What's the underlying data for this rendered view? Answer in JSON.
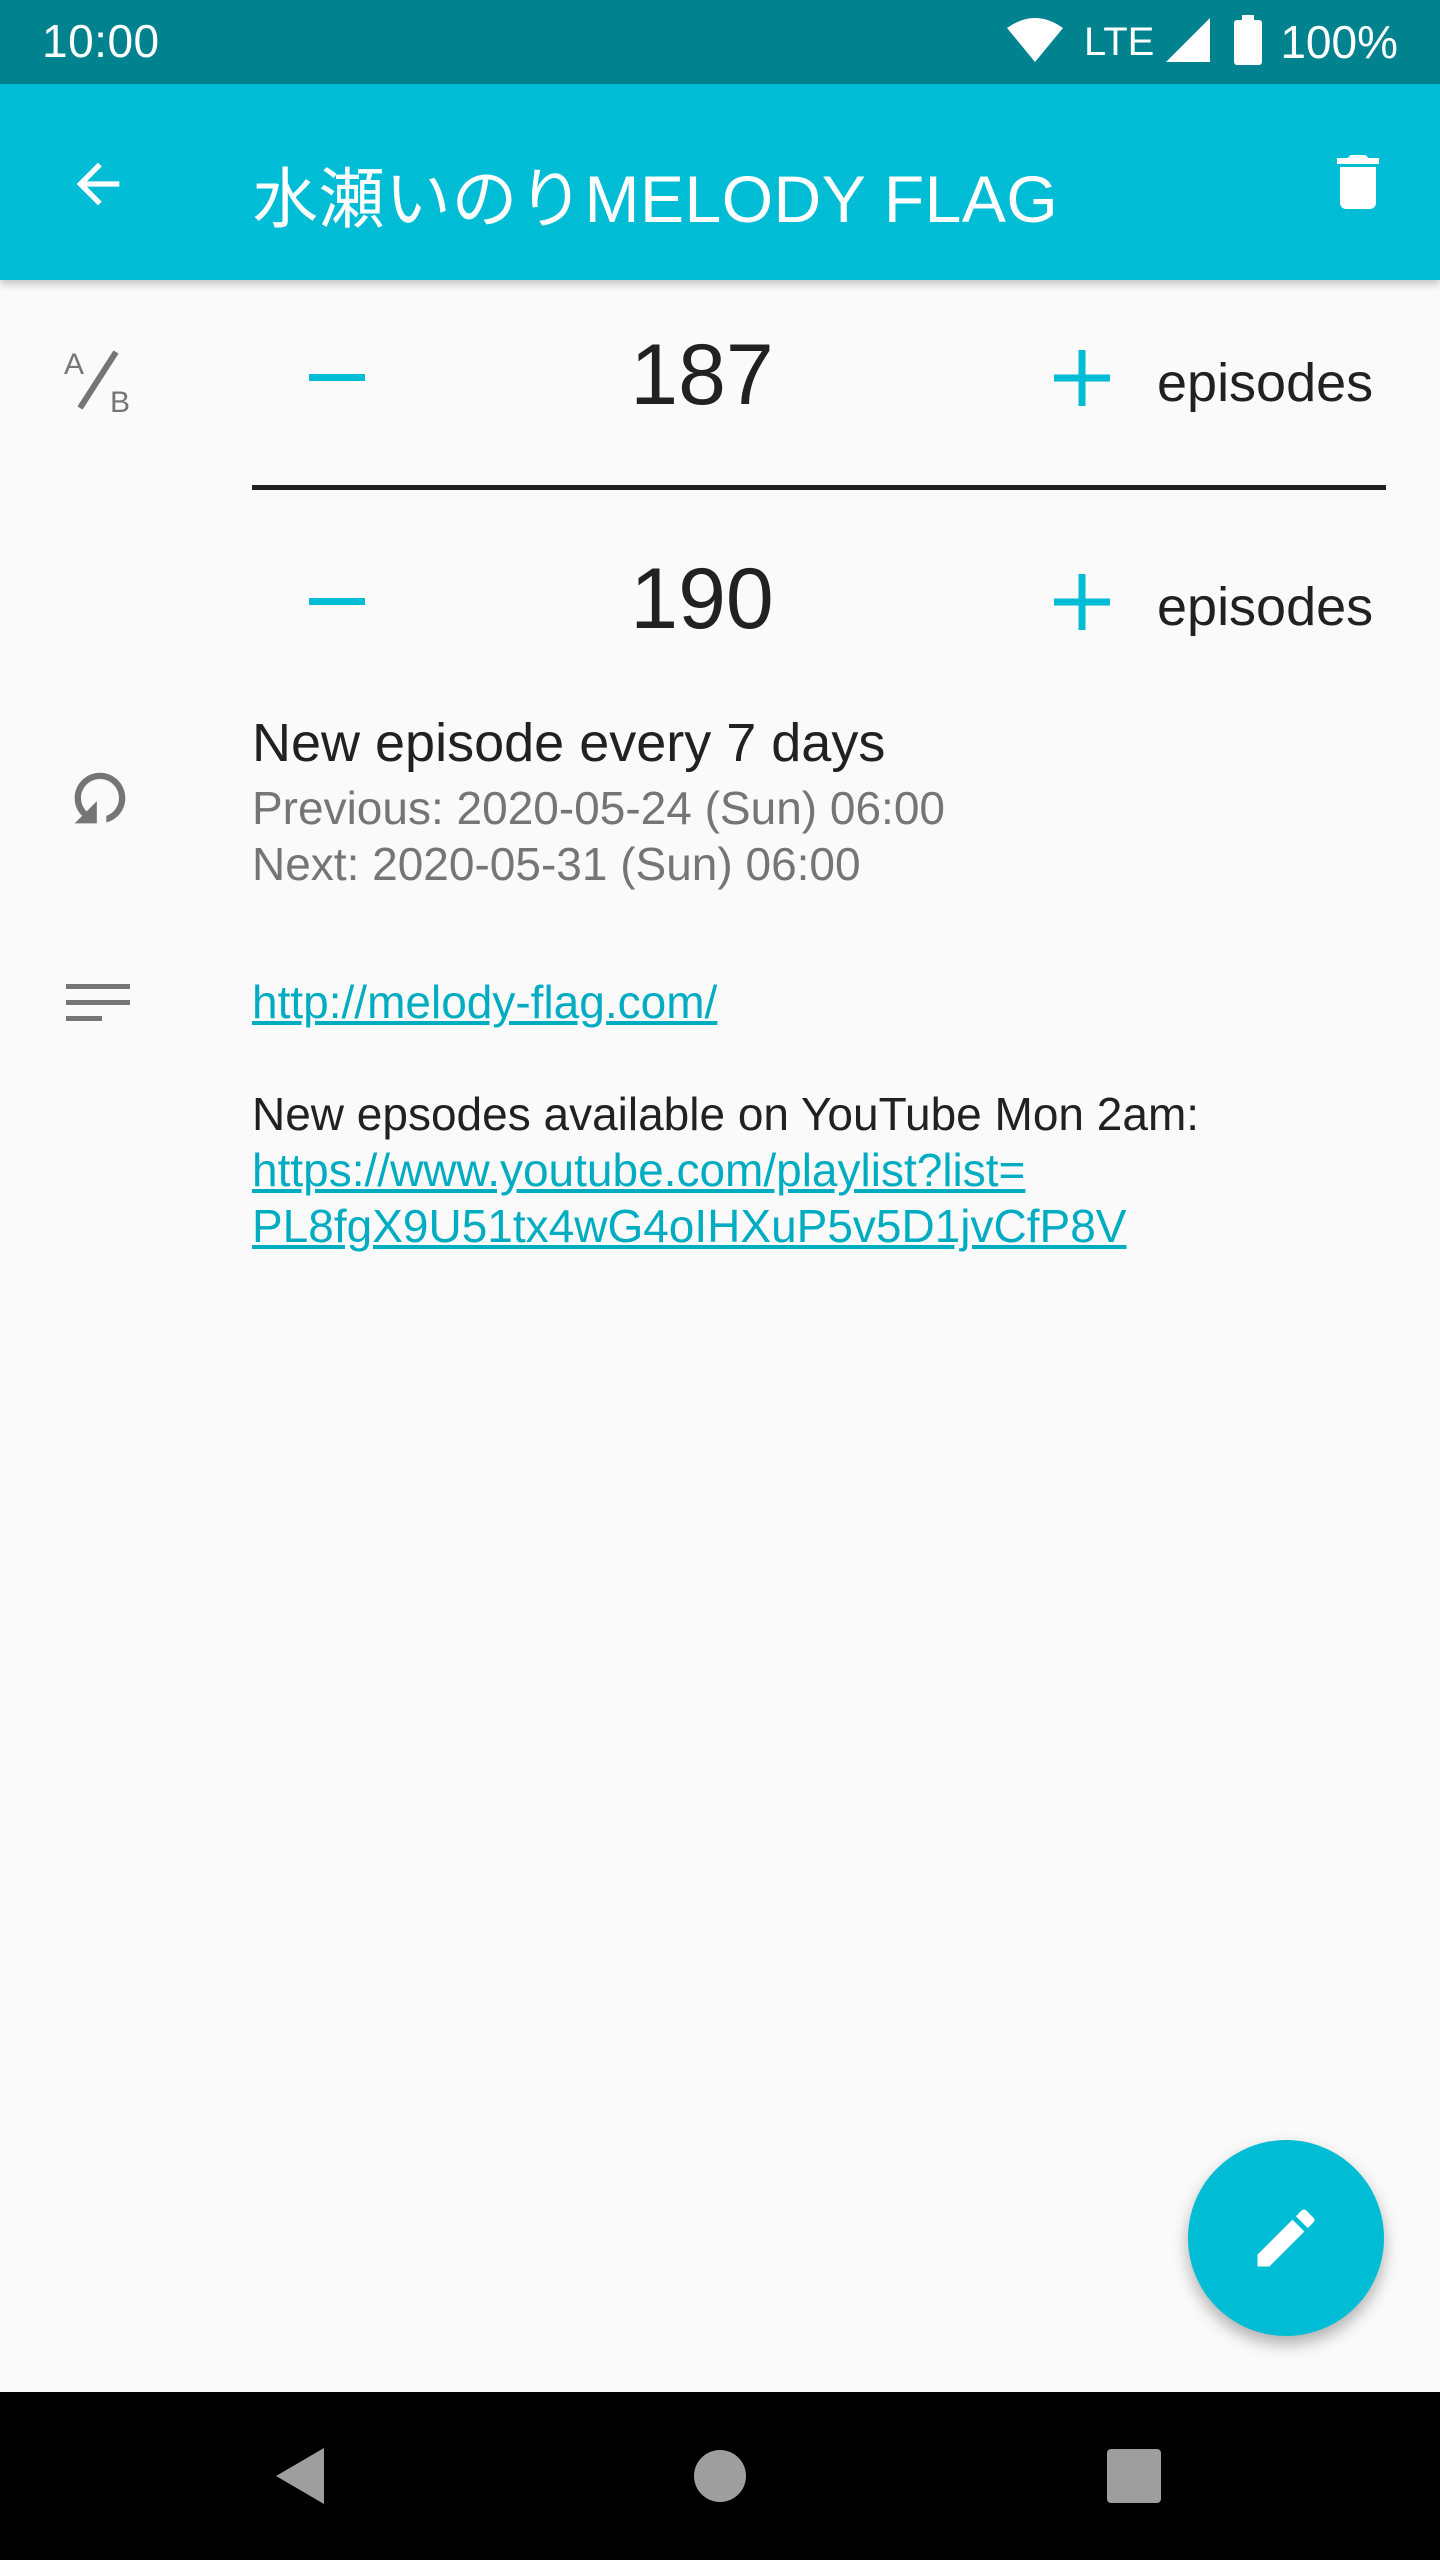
{
  "status_bar": {
    "time": "10:00",
    "network": "LTE",
    "battery": "100%",
    "icons": [
      "wifi-icon",
      "signal-icon",
      "battery-icon"
    ]
  },
  "app_bar": {
    "title": "水瀬いのりMELODY FLAG",
    "back_icon": "arrow-back-icon",
    "delete_icon": "trash-icon",
    "color": "#00bcd4"
  },
  "counters": [
    {
      "value": "187",
      "unit": "episodes"
    },
    {
      "value": "190",
      "unit": "episodes"
    }
  ],
  "schedule": {
    "main": "New episode every 7 days",
    "previous": "Previous: 2020-05-24 (Sun) 06:00",
    "next": "Next: 2020-05-31 (Sun) 06:00"
  },
  "notes": {
    "link1": "http://melody-flag.com/",
    "text": "New epsodes available on YouTube Mon 2am:",
    "link2_line1": "https://www.youtube.com/playlist?list=",
    "link2_line2": "PL8fgX9U51tx4wG4oIHXuP5v5D1jvCfP8V"
  },
  "fab": {
    "icon": "pencil-icon"
  },
  "colors": {
    "accent": "#00bcd4",
    "status_bar": "#00838f",
    "link": "#00acc1"
  },
  "nav": [
    "back-triangle-icon",
    "home-circle-icon",
    "recents-square-icon"
  ]
}
